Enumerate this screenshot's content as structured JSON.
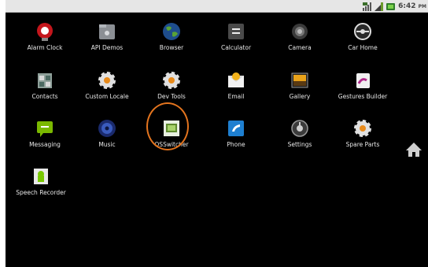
{
  "status_bar": {
    "time": "6:42",
    "ampm": "PM",
    "icons": [
      "wifi-icon",
      "signal-icon",
      "battery-icon"
    ]
  },
  "colors": {
    "background": "#000000",
    "status_bar": "#e6e6e6",
    "highlight": "#e3741e",
    "label": "#e8e8e8"
  },
  "apps": [
    {
      "label": "Alarm Clock",
      "icon": "alarm-clock-icon"
    },
    {
      "label": "API Demos",
      "icon": "folder-icon"
    },
    {
      "label": "Browser",
      "icon": "globe-icon"
    },
    {
      "label": "Calculator",
      "icon": "calculator-icon"
    },
    {
      "label": "Camera",
      "icon": "camera-icon"
    },
    {
      "label": "Car Home",
      "icon": "steering-wheel-icon"
    },
    {
      "label": "Contacts",
      "icon": "contacts-icon"
    },
    {
      "label": "Custom Locale",
      "icon": "gear-icon"
    },
    {
      "label": "Dev Tools",
      "icon": "gear-icon"
    },
    {
      "label": "Email",
      "icon": "email-icon"
    },
    {
      "label": "Gallery",
      "icon": "gallery-icon"
    },
    {
      "label": "Gestures Builder",
      "icon": "gestures-icon"
    },
    {
      "label": "Messaging",
      "icon": "message-icon"
    },
    {
      "label": "Music",
      "icon": "speaker-icon"
    },
    {
      "label": "OSSwitcher",
      "icon": "osswitcher-icon",
      "highlighted": true
    },
    {
      "label": "Phone",
      "icon": "phone-icon"
    },
    {
      "label": "Settings",
      "icon": "settings-icon"
    },
    {
      "label": "Spare Parts",
      "icon": "gear-icon"
    },
    {
      "label": "Speech Recorder",
      "icon": "android-icon"
    }
  ],
  "home_button": {
    "icon": "home-icon"
  }
}
